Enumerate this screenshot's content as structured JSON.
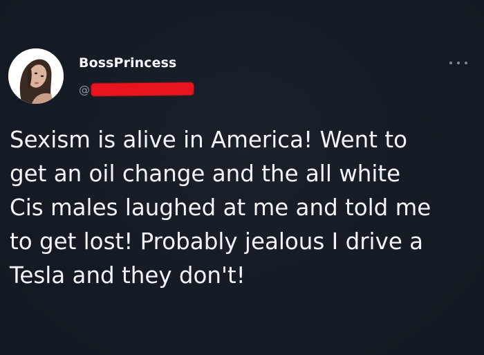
{
  "tweet": {
    "author": {
      "display_name": "BossPrincess",
      "handle_prefix": "@",
      "avatar_icon": "profile-photo"
    },
    "more_icon": "more-options-icon",
    "text_lines": [
      "Sexism is alive in America! Went to",
      "get an oil change and the all white",
      "Cis males laughed at me and told me",
      "to get lost! Probably jealous I drive a",
      "Tesla and they don't!"
    ]
  },
  "colors": {
    "background": "#151b24",
    "text": "#f3f5f8",
    "muted": "#8b97a6",
    "redaction": "#e8141e"
  }
}
